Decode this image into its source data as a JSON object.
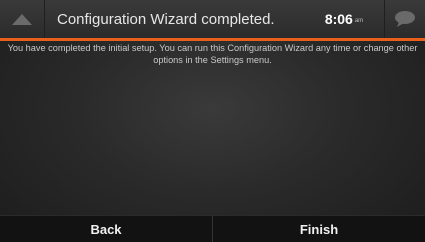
{
  "header": {
    "title": "Configuration Wizard completed.",
    "time": "8:06",
    "ampm": "am",
    "back_icon": "up-triangle-icon",
    "message_icon": "speech-bubble-icon",
    "accent_color": "#e8601c"
  },
  "body": {
    "message": "You have completed the initial setup. You can run this Configuration Wizard any time or change other options in the Settings menu."
  },
  "footer": {
    "back_label": "Back",
    "finish_label": "Finish"
  }
}
